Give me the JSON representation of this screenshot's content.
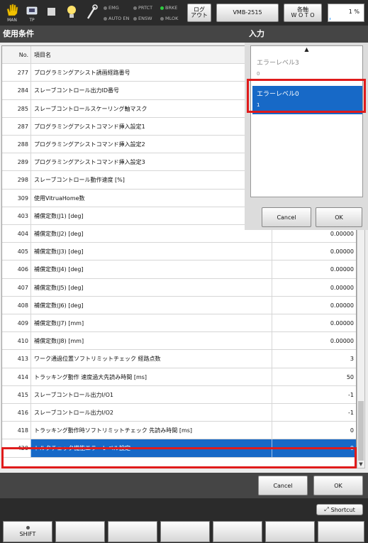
{
  "topbar": {
    "icons": [
      {
        "icon": "hand-icon",
        "label": "MAN"
      },
      {
        "icon": "teach-pendant-icon",
        "label": "TP"
      },
      {
        "icon": "stop-icon",
        "label": ""
      },
      {
        "icon": "bulb-icon",
        "label": ""
      },
      {
        "icon": "wrench-icon",
        "label": ""
      }
    ],
    "lamps": [
      {
        "label": "EMG",
        "on": false
      },
      {
        "label": "PRTCT",
        "on": false
      },
      {
        "label": "BRKE",
        "on": true
      },
      {
        "label": "AUTO EN",
        "on": false
      },
      {
        "label": "ENSW",
        "on": false
      },
      {
        "label": "MLOK",
        "on": false
      }
    ],
    "logout_line1": "ログ",
    "logout_line2": "アウト",
    "robot_name": "VMB-2515",
    "coord_line1": "各軸",
    "coord_line2": "W O T O",
    "override": "1 %",
    "override_fraction": 0.01
  },
  "left_panel": {
    "title": "使用条件",
    "header": {
      "no": "No.",
      "name": "項目名"
    },
    "rows": [
      {
        "no": "277",
        "name": "プログラミングアシスト誘画経路番号",
        "value": ""
      },
      {
        "no": "284",
        "name": "スレーブコントロール出力ID番号",
        "value": ""
      },
      {
        "no": "285",
        "name": "スレーブコントロールスケーリング軸マスク",
        "value": ""
      },
      {
        "no": "287",
        "name": "プログラミングアシストコマンド挿入設定1",
        "value": ""
      },
      {
        "no": "288",
        "name": "プログラミングアシストコマンド挿入設定2",
        "value": ""
      },
      {
        "no": "289",
        "name": "プログラミングアシストコマンド挿入設定3",
        "value": ""
      },
      {
        "no": "298",
        "name": "スレーブコントロール動作速度 [%]",
        "value": ""
      },
      {
        "no": "309",
        "name": "使用VitruaHome数",
        "value": ""
      },
      {
        "no": "403",
        "name": "補償定数(J1) [deg]",
        "value": ""
      },
      {
        "no": "404",
        "name": "補償定数(J2) [deg]",
        "value": "0.00000"
      },
      {
        "no": "405",
        "name": "補償定数(J3) [deg]",
        "value": "0.00000"
      },
      {
        "no": "406",
        "name": "補償定数(J4) [deg]",
        "value": "0.00000"
      },
      {
        "no": "407",
        "name": "補償定数(J5) [deg]",
        "value": "0.00000"
      },
      {
        "no": "408",
        "name": "補償定数(J6) [deg]",
        "value": "0.00000"
      },
      {
        "no": "409",
        "name": "補償定数(J7) [mm]",
        "value": "0.00000"
      },
      {
        "no": "410",
        "name": "補償定数(J8) [mm]",
        "value": "0.00000"
      },
      {
        "no": "413",
        "name": "ワーク通過位置ソフトリミットチェック 経路点数",
        "value": "3"
      },
      {
        "no": "414",
        "name": "トラッキング動作 速度過大先読み時間 [ms]",
        "value": "50"
      },
      {
        "no": "415",
        "name": "スレーブコントロール出力I/O1",
        "value": "-1"
      },
      {
        "no": "416",
        "name": "スレーブコントロール出力I/O2",
        "value": "-1"
      },
      {
        "no": "418",
        "name": "トラッキング動作時ソフトリミットチェック 先読み時間 [ms]",
        "value": "0"
      },
      {
        "no": "420",
        "name": "トルクチェック機能エラーレベル設定",
        "value": "0"
      }
    ]
  },
  "input_panel": {
    "title": "入力",
    "options": [
      {
        "name": "エラーレベル3",
        "value": "0"
      },
      {
        "name": "エラーレベル0",
        "value": "1"
      }
    ],
    "cancel": "Cancel",
    "ok": "OK"
  },
  "bottom": {
    "cancel": "Cancel",
    "ok": "OK"
  },
  "shortcut": {
    "label": "Shortcut",
    "shift": "SHIFT"
  }
}
